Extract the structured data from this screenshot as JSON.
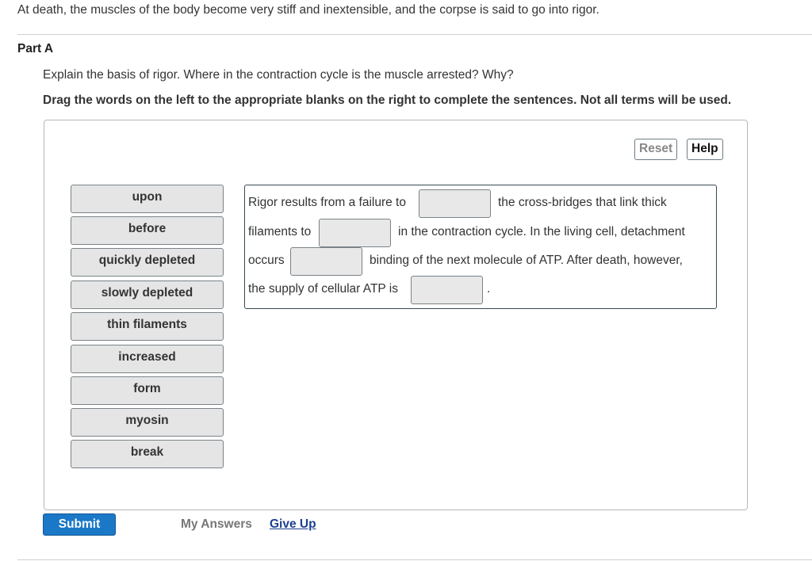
{
  "intro": "At death, the muscles of the body become very stiff and inextensible, and the corpse is said to go into rigor.",
  "part": {
    "title": "Part A",
    "question": "Explain the basis of rigor. Where in the contraction cycle is the muscle arrested? Why?",
    "instructions": "Drag the words on the left to the appropriate blanks on the right to complete the sentences. Not all terms will be used."
  },
  "toolbar": {
    "reset_label": "Reset",
    "help_label": "Help"
  },
  "terms": [
    "upon",
    "before",
    "quickly depleted",
    "slowly depleted",
    "thin filaments",
    "increased",
    "form",
    "myosin",
    "break"
  ],
  "sentence": {
    "segments": [
      "Rigor results from a failure to",
      "the cross-bridges that link thick",
      "filaments to",
      "in the contraction cycle. In the living cell, detachment",
      "occurs",
      "binding of the next molecule of ATP. After death, however,",
      "the supply of cellular ATP is",
      "."
    ],
    "blanks": [
      "",
      "",
      "",
      ""
    ]
  },
  "footer": {
    "submit_label": "Submit",
    "my_answers_label": "My Answers",
    "give_up_label": "Give Up"
  },
  "colors": {
    "submit_bg": "#1a78c7",
    "link": "#1b3f8f",
    "term_bg": "#e5e5e5"
  }
}
